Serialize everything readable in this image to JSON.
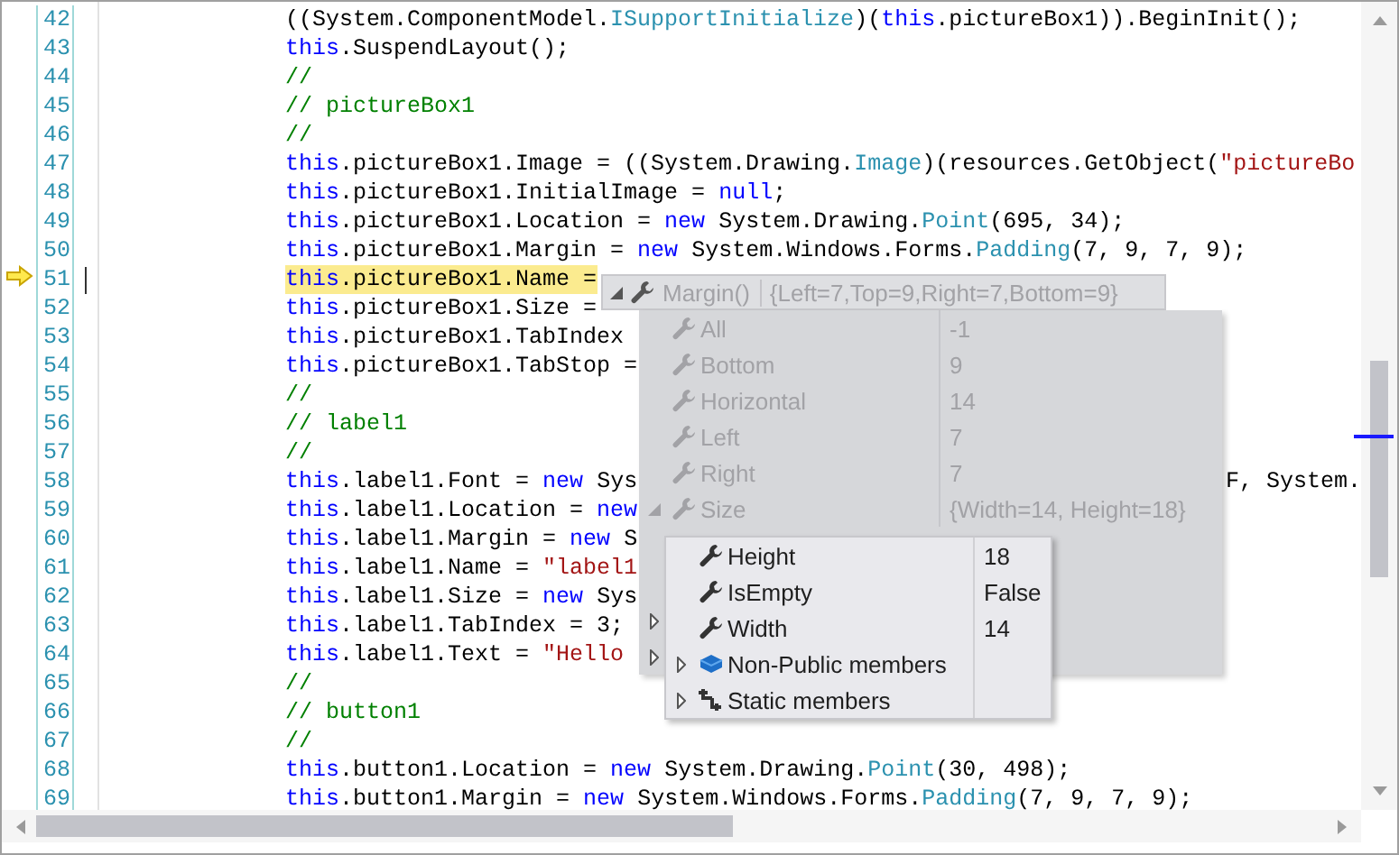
{
  "editor": {
    "lines": [
      {
        "number": "42",
        "current": false,
        "tokens": [
          {
            "kind": "plain",
            "text": "((System.ComponentModel."
          },
          {
            "kind": "type",
            "text": "ISupportInitialize"
          },
          {
            "kind": "plain",
            "text": ")("
          },
          {
            "kind": "keyword",
            "text": "this"
          },
          {
            "kind": "plain",
            "text": ".pictureBox1)).BeginInit();"
          }
        ]
      },
      {
        "number": "43",
        "current": false,
        "tokens": [
          {
            "kind": "keyword",
            "text": "this"
          },
          {
            "kind": "plain",
            "text": ".SuspendLayout();"
          }
        ]
      },
      {
        "number": "44",
        "current": false,
        "tokens": [
          {
            "kind": "comment",
            "text": "//"
          }
        ]
      },
      {
        "number": "45",
        "current": false,
        "tokens": [
          {
            "kind": "comment",
            "text": "// pictureBox1"
          }
        ]
      },
      {
        "number": "46",
        "current": false,
        "tokens": [
          {
            "kind": "comment",
            "text": "//"
          }
        ]
      },
      {
        "number": "47",
        "current": false,
        "tokens": [
          {
            "kind": "keyword",
            "text": "this"
          },
          {
            "kind": "plain",
            "text": ".pictureBox1.Image = ((System.Drawing."
          },
          {
            "kind": "type",
            "text": "Image"
          },
          {
            "kind": "plain",
            "text": ")(resources.GetObject("
          },
          {
            "kind": "string",
            "text": "\"pictureBo"
          }
        ]
      },
      {
        "number": "48",
        "current": false,
        "tokens": [
          {
            "kind": "keyword",
            "text": "this"
          },
          {
            "kind": "plain",
            "text": ".pictureBox1.InitialImage = "
          },
          {
            "kind": "keyword",
            "text": "null"
          },
          {
            "kind": "plain",
            "text": ";"
          }
        ]
      },
      {
        "number": "49",
        "current": false,
        "tokens": [
          {
            "kind": "keyword",
            "text": "this"
          },
          {
            "kind": "plain",
            "text": ".pictureBox1.Location = "
          },
          {
            "kind": "keyword",
            "text": "new"
          },
          {
            "kind": "plain",
            "text": " System.Drawing."
          },
          {
            "kind": "type",
            "text": "Point"
          },
          {
            "kind": "plain",
            "text": "(695, 34);"
          }
        ]
      },
      {
        "number": "50",
        "current": false,
        "tokens": [
          {
            "kind": "keyword",
            "text": "this"
          },
          {
            "kind": "plain",
            "text": ".pictureBox1.Margin = "
          },
          {
            "kind": "keyword",
            "text": "new"
          },
          {
            "kind": "plain",
            "text": " System.Windows.Forms."
          },
          {
            "kind": "type",
            "text": "Padding"
          },
          {
            "kind": "plain",
            "text": "(7, 9, 7, 9);"
          }
        ]
      },
      {
        "number": "51",
        "current": true,
        "tokens": [
          {
            "kind": "keyword",
            "text": "this"
          },
          {
            "kind": "plain",
            "text": ".pictureBox1.Name ="
          }
        ]
      },
      {
        "number": "52",
        "current": false,
        "tokens": [
          {
            "kind": "keyword",
            "text": "this"
          },
          {
            "kind": "plain",
            "text": ".pictureBox1.Size ="
          }
        ]
      },
      {
        "number": "53",
        "current": false,
        "tokens": [
          {
            "kind": "keyword",
            "text": "this"
          },
          {
            "kind": "plain",
            "text": ".pictureBox1.TabIndex"
          }
        ]
      },
      {
        "number": "54",
        "current": false,
        "tokens": [
          {
            "kind": "keyword",
            "text": "this"
          },
          {
            "kind": "plain",
            "text": ".pictureBox1.TabStop ="
          }
        ]
      },
      {
        "number": "55",
        "current": false,
        "tokens": [
          {
            "kind": "comment",
            "text": "//"
          }
        ]
      },
      {
        "number": "56",
        "current": false,
        "tokens": [
          {
            "kind": "comment",
            "text": "// label1"
          }
        ]
      },
      {
        "number": "57",
        "current": false,
        "tokens": [
          {
            "kind": "comment",
            "text": "//"
          }
        ]
      },
      {
        "number": "58",
        "current": false,
        "tokens": [
          {
            "kind": "keyword",
            "text": "this"
          },
          {
            "kind": "plain",
            "text": ".label1.Font = "
          },
          {
            "kind": "keyword",
            "text": "new"
          },
          {
            "kind": "plain",
            "text": " Sys"
          }
        ],
        "tail": "F, System."
      },
      {
        "number": "59",
        "current": false,
        "tokens": [
          {
            "kind": "keyword",
            "text": "this"
          },
          {
            "kind": "plain",
            "text": ".label1.Location = "
          },
          {
            "kind": "keyword",
            "text": "new"
          }
        ]
      },
      {
        "number": "60",
        "current": false,
        "tokens": [
          {
            "kind": "keyword",
            "text": "this"
          },
          {
            "kind": "plain",
            "text": ".label1.Margin = "
          },
          {
            "kind": "keyword",
            "text": "new"
          },
          {
            "kind": "plain",
            "text": " S"
          }
        ]
      },
      {
        "number": "61",
        "current": false,
        "tokens": [
          {
            "kind": "keyword",
            "text": "this"
          },
          {
            "kind": "plain",
            "text": ".label1.Name = "
          },
          {
            "kind": "string",
            "text": "\"label1"
          }
        ]
      },
      {
        "number": "62",
        "current": false,
        "tokens": [
          {
            "kind": "keyword",
            "text": "this"
          },
          {
            "kind": "plain",
            "text": ".label1.Size = "
          },
          {
            "kind": "keyword",
            "text": "new"
          },
          {
            "kind": "plain",
            "text": " Sys"
          }
        ]
      },
      {
        "number": "63",
        "current": false,
        "tokens": [
          {
            "kind": "keyword",
            "text": "this"
          },
          {
            "kind": "plain",
            "text": ".label1.TabIndex = 3;"
          }
        ]
      },
      {
        "number": "64",
        "current": false,
        "tokens": [
          {
            "kind": "keyword",
            "text": "this"
          },
          {
            "kind": "plain",
            "text": ".label1.Text = "
          },
          {
            "kind": "string",
            "text": "\"Hello"
          }
        ]
      },
      {
        "number": "65",
        "current": false,
        "tokens": [
          {
            "kind": "comment",
            "text": "//"
          }
        ]
      },
      {
        "number": "66",
        "current": false,
        "tokens": [
          {
            "kind": "comment",
            "text": "// button1"
          }
        ]
      },
      {
        "number": "67",
        "current": false,
        "tokens": [
          {
            "kind": "comment",
            "text": "//"
          }
        ]
      },
      {
        "number": "68",
        "current": false,
        "tokens": [
          {
            "kind": "keyword",
            "text": "this"
          },
          {
            "kind": "plain",
            "text": ".button1.Location = "
          },
          {
            "kind": "keyword",
            "text": "new"
          },
          {
            "kind": "plain",
            "text": " System.Drawing."
          },
          {
            "kind": "type",
            "text": "Point"
          },
          {
            "kind": "plain",
            "text": "(30, 498);"
          }
        ]
      },
      {
        "number": "69",
        "current": false,
        "tokens": [
          {
            "kind": "keyword",
            "text": "this"
          },
          {
            "kind": "plain",
            "text": ".button1.Margin = "
          },
          {
            "kind": "keyword",
            "text": "new"
          },
          {
            "kind": "plain",
            "text": " System.Windows.Forms."
          },
          {
            "kind": "type",
            "text": "Padding"
          },
          {
            "kind": "plain",
            "text": "(7, 9, 7, 9);"
          }
        ]
      }
    ]
  },
  "datatip": {
    "header": {
      "kind": "expandable",
      "expanded": true,
      "name": "Margin()",
      "value": "{Left=7,Top=9,Right=7,Bottom=9}"
    },
    "active": false,
    "rows": [
      {
        "kind": "property",
        "name": "All",
        "value": "-1"
      },
      {
        "kind": "property",
        "name": "Bottom",
        "value": "9"
      },
      {
        "kind": "property",
        "name": "Horizontal",
        "value": "14"
      },
      {
        "kind": "property",
        "name": "Left",
        "value": "7"
      },
      {
        "kind": "property",
        "name": "Right",
        "value": "7"
      },
      {
        "kind": "expandable",
        "expanded": true,
        "name": "Size",
        "value": "{Width=14, Height=18}"
      }
    ],
    "covered_rows": [
      {
        "kind": "covered",
        "expanded": false
      },
      {
        "kind": "covered",
        "expanded": false
      }
    ],
    "child": {
      "active": true,
      "rows": [
        {
          "kind": "property",
          "name": "Height",
          "value": "18"
        },
        {
          "kind": "property",
          "name": "IsEmpty",
          "value": "False"
        },
        {
          "kind": "property",
          "name": "Width",
          "value": "14"
        },
        {
          "kind": "nonpublic",
          "expanded": false,
          "name": "Non-Public members"
        },
        {
          "kind": "static",
          "expanded": false,
          "name": "Static members"
        }
      ]
    }
  }
}
